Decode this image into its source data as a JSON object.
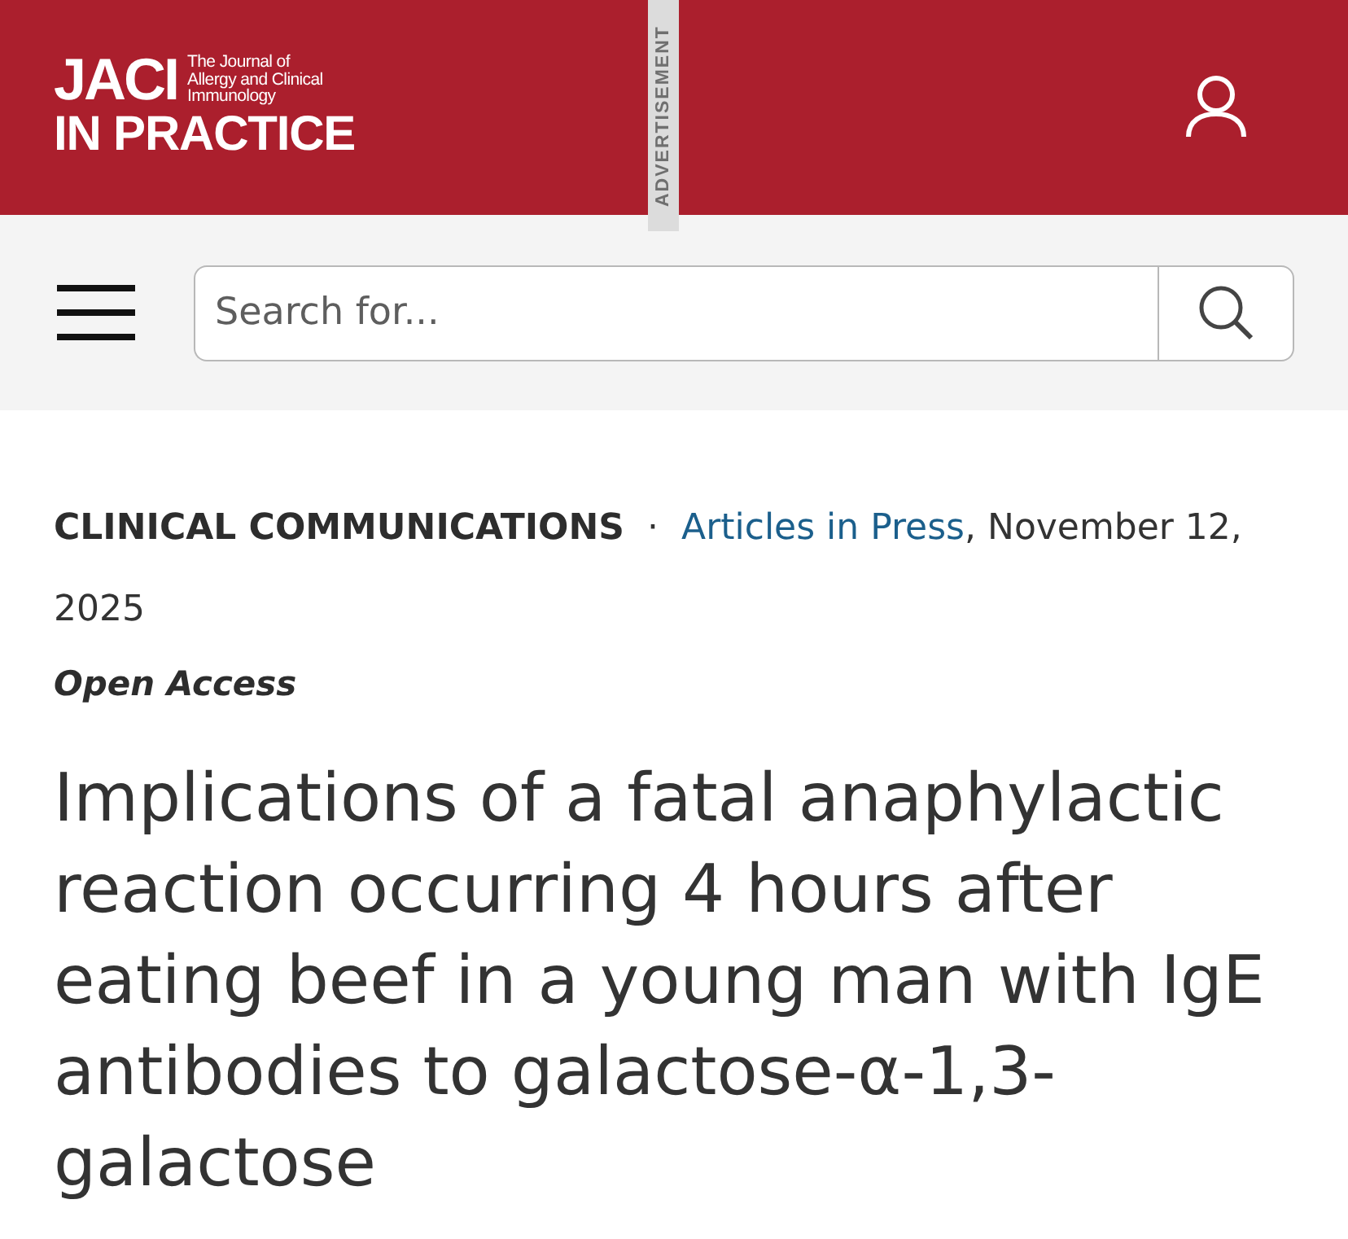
{
  "header": {
    "logo": {
      "wordmark": "JACI",
      "subtitle_lines": [
        "The Journal of",
        "Allergy and Clinical",
        "Immunology"
      ],
      "tagline": "IN PRACTICE"
    },
    "advertisement_label": "ADVERTISEMENT"
  },
  "search_bar": {
    "placeholder": "Search for..."
  },
  "article": {
    "category": "CLINICAL COMMUNICATIONS",
    "separator": "·",
    "issue_link": "Articles in Press",
    "date": ", November 12, 2025",
    "access": "Open Access",
    "title": "Implications of a fatal anaphylactic reaction occurring 4 hours after eating beef in a young man with IgE antibodies to galactose-α-1,3-galactose"
  }
}
